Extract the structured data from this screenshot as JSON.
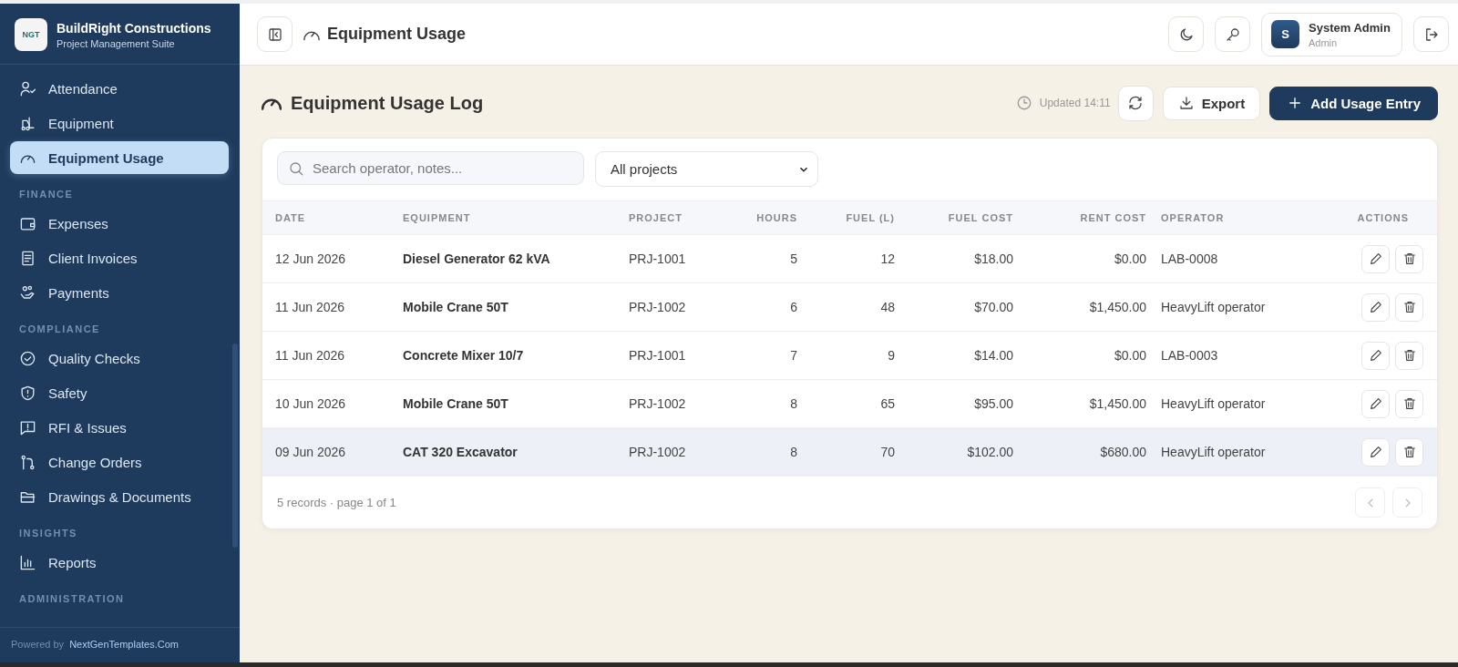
{
  "brand": {
    "logo_text": "NGT",
    "name": "BuildRight Constructions",
    "subtitle": "Project Management Suite"
  },
  "sidebar": {
    "sections": [
      {
        "items": [
          {
            "label": "Attendance",
            "selected": false
          },
          {
            "label": "Equipment",
            "selected": false
          },
          {
            "label": "Equipment Usage",
            "selected": true
          }
        ]
      },
      {
        "heading": "FINANCE",
        "items": [
          {
            "label": "Expenses",
            "selected": false
          },
          {
            "label": "Client Invoices",
            "selected": false
          },
          {
            "label": "Payments",
            "selected": false
          }
        ]
      },
      {
        "heading": "COMPLIANCE",
        "items": [
          {
            "label": "Quality Checks",
            "selected": false
          },
          {
            "label": "Safety",
            "selected": false
          },
          {
            "label": "RFI & Issues",
            "selected": false
          },
          {
            "label": "Change Orders",
            "selected": false
          },
          {
            "label": "Drawings & Documents",
            "selected": false
          }
        ]
      },
      {
        "heading": "INSIGHTS",
        "items": [
          {
            "label": "Reports",
            "selected": false
          }
        ]
      },
      {
        "heading": "ADMINISTRATION"
      }
    ],
    "footer": {
      "prefix": "Powered by",
      "link": "NextGenTemplates.Com"
    }
  },
  "header": {
    "title": "Equipment Usage",
    "user": {
      "initial": "S",
      "name": "System Admin",
      "role": "Admin"
    }
  },
  "page": {
    "title": "Equipment Usage Log",
    "updated": "Updated 14:11",
    "export": "Export",
    "add": "Add Usage Entry"
  },
  "filters": {
    "search_placeholder": "Search operator, notes...",
    "project": "All projects"
  },
  "table": {
    "columns": [
      "DATE",
      "EQUIPMENT",
      "PROJECT",
      "HOURS",
      "FUEL (L)",
      "FUEL COST",
      "RENT COST",
      "OPERATOR",
      "ACTIONS"
    ],
    "rows": [
      {
        "date": "12 Jun 2026",
        "equipment": "Diesel Generator 62 kVA",
        "project": "PRJ-1001",
        "hours": "5",
        "fuel": "12",
        "fuel_cost": "$18.00",
        "rent_cost": "$0.00",
        "operator": "LAB-0008",
        "selected": false
      },
      {
        "date": "11 Jun 2026",
        "equipment": "Mobile Crane 50T",
        "project": "PRJ-1002",
        "hours": "6",
        "fuel": "48",
        "fuel_cost": "$70.00",
        "rent_cost": "$1,450.00",
        "operator": "HeavyLift operator",
        "selected": false
      },
      {
        "date": "11 Jun 2026",
        "equipment": "Concrete Mixer 10/7",
        "project": "PRJ-1001",
        "hours": "7",
        "fuel": "9",
        "fuel_cost": "$14.00",
        "rent_cost": "$0.00",
        "operator": "LAB-0003",
        "selected": false
      },
      {
        "date": "10 Jun 2026",
        "equipment": "Mobile Crane 50T",
        "project": "PRJ-1002",
        "hours": "8",
        "fuel": "65",
        "fuel_cost": "$95.00",
        "rent_cost": "$1,450.00",
        "operator": "HeavyLift operator",
        "selected": false
      },
      {
        "date": "09 Jun 2026",
        "equipment": "CAT 320 Excavator",
        "project": "PRJ-1002",
        "hours": "8",
        "fuel": "70",
        "fuel_cost": "$102.00",
        "rent_cost": "$680.00",
        "operator": "HeavyLift operator",
        "selected": true
      }
    ],
    "summary": "5 records · page 1 of 1"
  }
}
